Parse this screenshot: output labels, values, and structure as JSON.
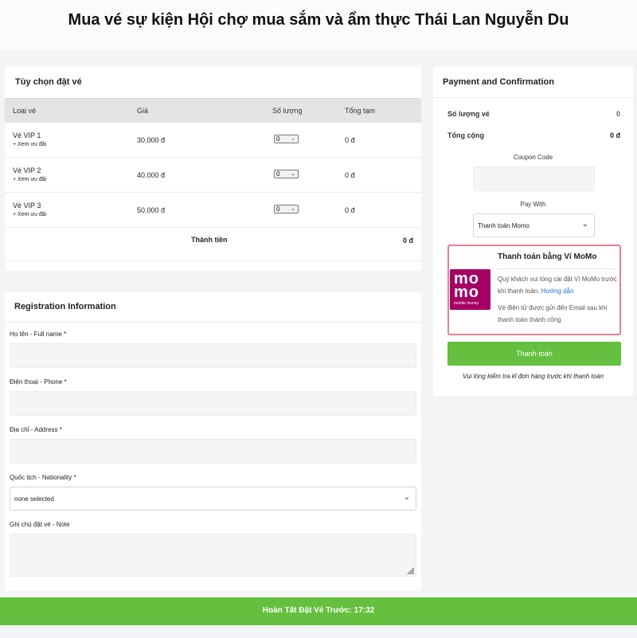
{
  "page": {
    "title": "Mua vé sự kiện Hội chợ mua sắm và ẩm thực Thái Lan Nguyễn Du"
  },
  "tickets": {
    "title": "Tùy chọn đặt vé",
    "headers": {
      "type": "Loại vé",
      "price": "Giá",
      "qty": "Số lượng",
      "subtotal": "Tổng tạm"
    },
    "rows": [
      {
        "name": "Vé VIP 1",
        "link": "+ Xem ưu đãi",
        "price": "30.000 đ",
        "qty": "0",
        "subtotal": "0 đ"
      },
      {
        "name": "Vé VIP 2",
        "link": "+ Xem ưu đãi",
        "price": "40.000 đ",
        "qty": "0",
        "subtotal": "0 đ"
      },
      {
        "name": "Vé VIP 3",
        "link": "+ Xem ưu đãi",
        "price": "50.000 đ",
        "qty": "0",
        "subtotal": "0 đ"
      }
    ],
    "total_label": "Thành tiền",
    "total_value": "0 đ"
  },
  "registration": {
    "title": "Registration Information",
    "fullname_label": "Họ tên - Full name *",
    "phone_label": "Điện thoại - Phone *",
    "address_label": "Địa chỉ - Address *",
    "nationality_label": "Quốc tịch - Nationality *",
    "nationality_value": "none selected",
    "note_label": "Ghi chú đặt vé - Note"
  },
  "payment": {
    "title": "Payment and Confirmation",
    "qty_label": "Số lượng vé",
    "qty_value": "0",
    "total_label": "Tổng cộng",
    "total_value": "0 đ",
    "coupon_label": "Coupon Code",
    "paywith_label": "Pay With",
    "paywith_value": "Thanh toán Momo",
    "momo": {
      "title": "Thanh toán bằng Ví MoMo",
      "text1a": "Quý khách vui lòng cài đặt Ví MoMo trước khi thanh toán.",
      "text1_link": "Hướng dẫn",
      "text2": "Vé điện tử được gửi đến Email sau khi thanh toán thành công",
      "logo_line1": "mo",
      "logo_line2": "mo",
      "logo_line3": "mobile money"
    },
    "button_label": "Thanh toán",
    "note": "Vui lòng kiểm tra kĩ đơn hàng trước khi thanh toán"
  },
  "bottom_bar": {
    "text": "Hoàn Tất Đặt Vé Trước: 17:32"
  },
  "colors": {
    "accent_green": "#64c03e",
    "momo_pink": "#a50064",
    "momo_border": "#e87f93",
    "link_blue": "#1a6fd1"
  }
}
